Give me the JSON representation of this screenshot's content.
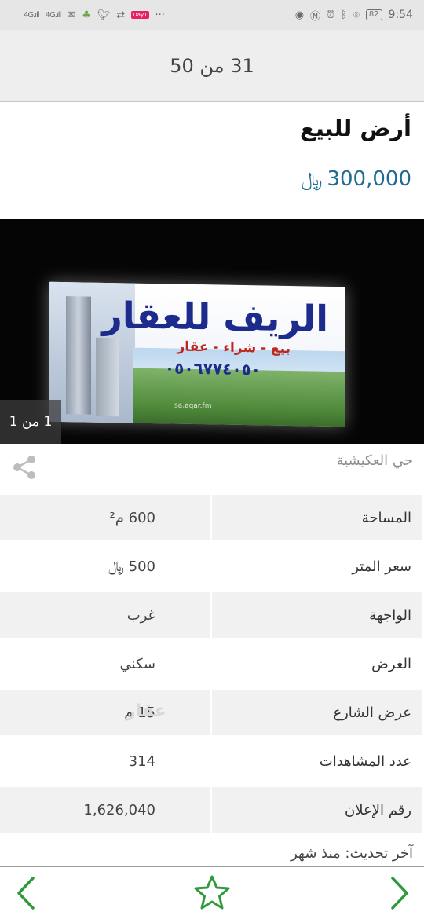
{
  "status_bar": {
    "time": "9:54",
    "battery": "82",
    "net1": "4G",
    "net2": "4G",
    "dots": "···",
    "app_badge": "Day1"
  },
  "header": {
    "counter": "31 من 50"
  },
  "listing": {
    "title": "أرض للبيع",
    "price": "300,000",
    "currency": "﷼",
    "photo_counter": "1 من 1",
    "district": "حي العكيشية"
  },
  "photo": {
    "sign_main": "الريف للعقار",
    "sign_sub": "بيع - شراء - عقار",
    "sign_phone": "٠٥٠٦٧٧٤٠٥٠",
    "sign_site": "sa.aqar.fm"
  },
  "details": [
    {
      "label": "المساحة",
      "value": "600 م²"
    },
    {
      "label": "سعر المتر",
      "value": "500 ﷼"
    },
    {
      "label": "الواجهة",
      "value": "غرب"
    },
    {
      "label": "الغرض",
      "value": "سكني"
    },
    {
      "label": "عرض الشارع",
      "value": "15 م"
    },
    {
      "label": "عدد المشاهدات",
      "value": "314"
    },
    {
      "label": "رقم الإعلان",
      "value": "1,626,040"
    }
  ],
  "watermark": "عقار",
  "updated": "آخر تحديث: منذ شهر",
  "icons": {
    "share": "share-icon",
    "prev": "chevron-left-icon",
    "next": "chevron-right-icon",
    "favorite": "star-outline-icon"
  },
  "colors": {
    "accent_green": "#2e9a3a",
    "price_blue": "#1f6b94"
  }
}
